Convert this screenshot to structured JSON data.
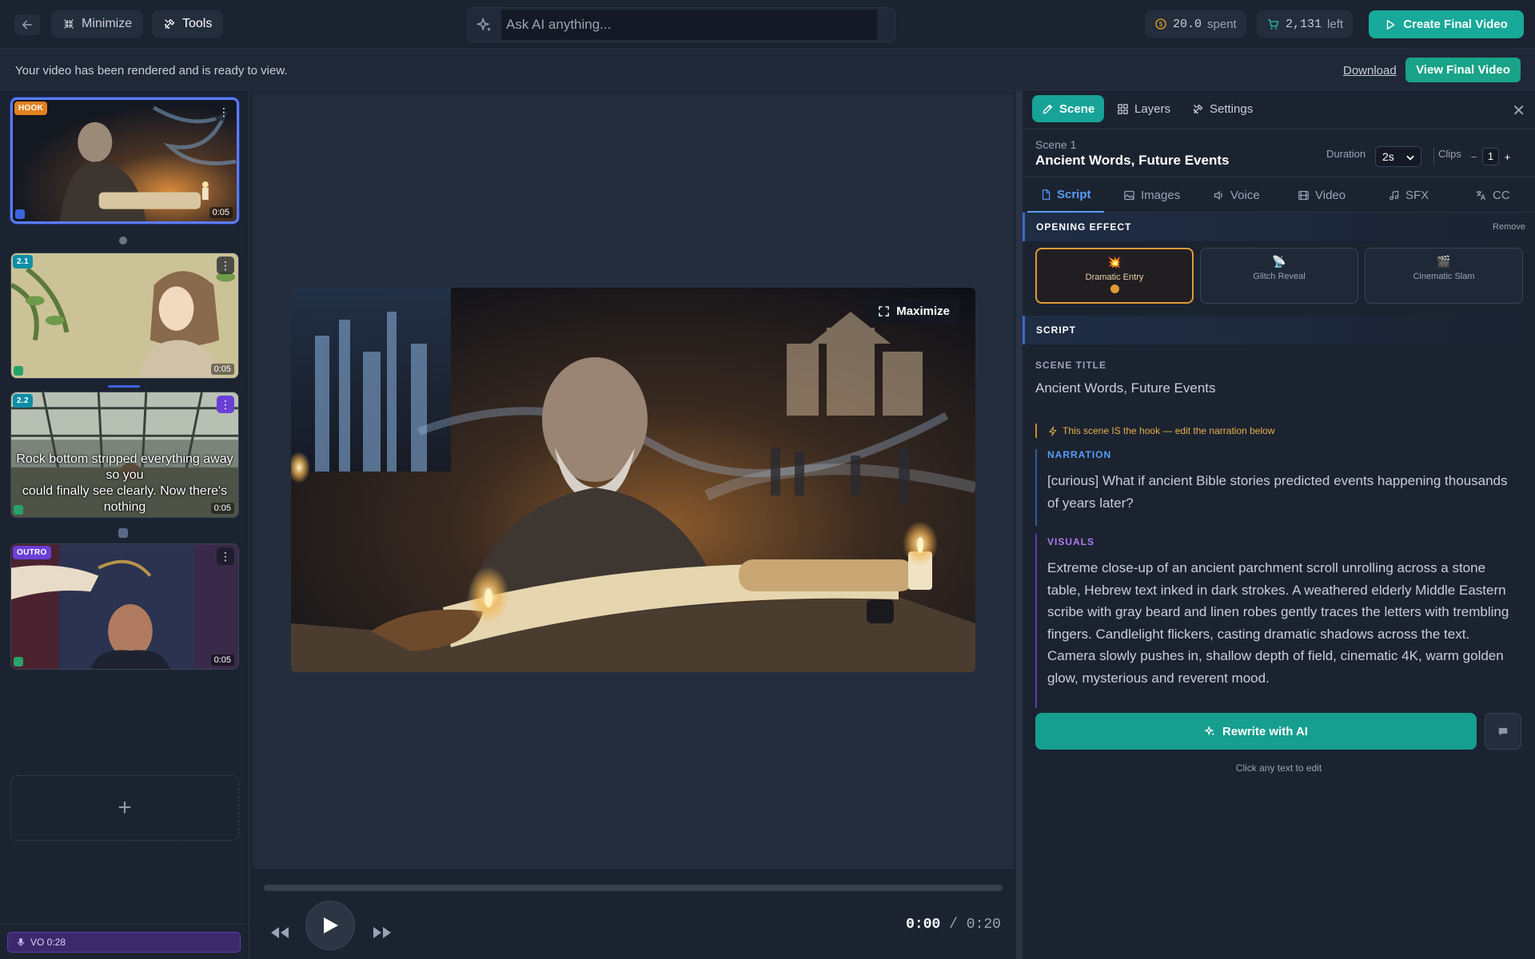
{
  "topbar": {
    "minimize_label": "Minimize",
    "tools_label": "Tools",
    "ask_placeholder": "Ask AI anything...",
    "spent_value": "20.0",
    "spent_label": "spent",
    "left_value": "2,131",
    "left_label": "left",
    "create_label": "Create Final Video"
  },
  "notice": {
    "message": "Your video has been rendered and is ready to view.",
    "download_label": "Download",
    "view_final_label": "View Final Video"
  },
  "scenes": [
    {
      "tag": "HOOK",
      "duration": "0:05",
      "caption": ""
    },
    {
      "tag": "2.1",
      "duration": "0:05",
      "caption": ""
    },
    {
      "tag": "2.2",
      "duration": "0:05",
      "caption_line1": "Rock bottom stripped everything away so you",
      "caption_line2": "could finally see clearly. Now there's nothing"
    },
    {
      "tag": "OUTRO",
      "duration": "0:05",
      "caption": ""
    }
  ],
  "add_scene_label": "+",
  "voiceover_label": "VO 0:28",
  "preview": {
    "maximize_label": "Maximize",
    "time_current": "0:00",
    "time_separator": "/",
    "time_total": "0:20",
    "progress_fraction": 0
  },
  "panel": {
    "tabs": [
      "Scene",
      "Layers",
      "Settings"
    ],
    "scene_number": "Scene 1",
    "scene_name": "Ancient Words, Future Events",
    "duration_label": "Duration",
    "duration_value": "2s",
    "clips_label": "Clips",
    "clips_minus": "−",
    "clips_value": "1",
    "clips_plus": "+",
    "subtabs": [
      "Script",
      "Images",
      "Voice",
      "Video",
      "SFX",
      "CC"
    ],
    "opening_effect_title": "OPENING EFFECT",
    "remove_label": "Remove",
    "effects": [
      "Dramatic Entry",
      "Glitch Reveal",
      "Cinematic Slam"
    ],
    "script_title": "SCRIPT",
    "scene_title_label": "SCENE TITLE",
    "scene_title_value": "Ancient Words, Future Events",
    "hook_note": "This scene IS the hook — edit the narration below",
    "narration_label": "NARRATION",
    "narration_text": "[curious] What if ancient Bible stories predicted events happening thousands of years later?",
    "visuals_label": "VISUALS",
    "visuals_text": "Extreme close-up of an ancient parchment scroll unrolling across a stone table, Hebrew text inked in dark strokes. A weathered elderly Middle Eastern scribe with gray beard and linen robes gently traces the letters with trembling fingers. Candlelight flickers, casting dramatic shadows across the text. Camera slowly pushes in, shallow depth of field, cinematic 4K, warm golden glow, mysterious and reverent mood.",
    "rewrite_label": "Rewrite with AI",
    "hint": "Click any text to edit"
  },
  "colors": {
    "accent": "#17a397",
    "active_thumb_border": "#5b7cf7",
    "hook_tag": "#e0811f",
    "outro_tag": "#6a3fd6",
    "tab_active": "#5b9cf7"
  }
}
